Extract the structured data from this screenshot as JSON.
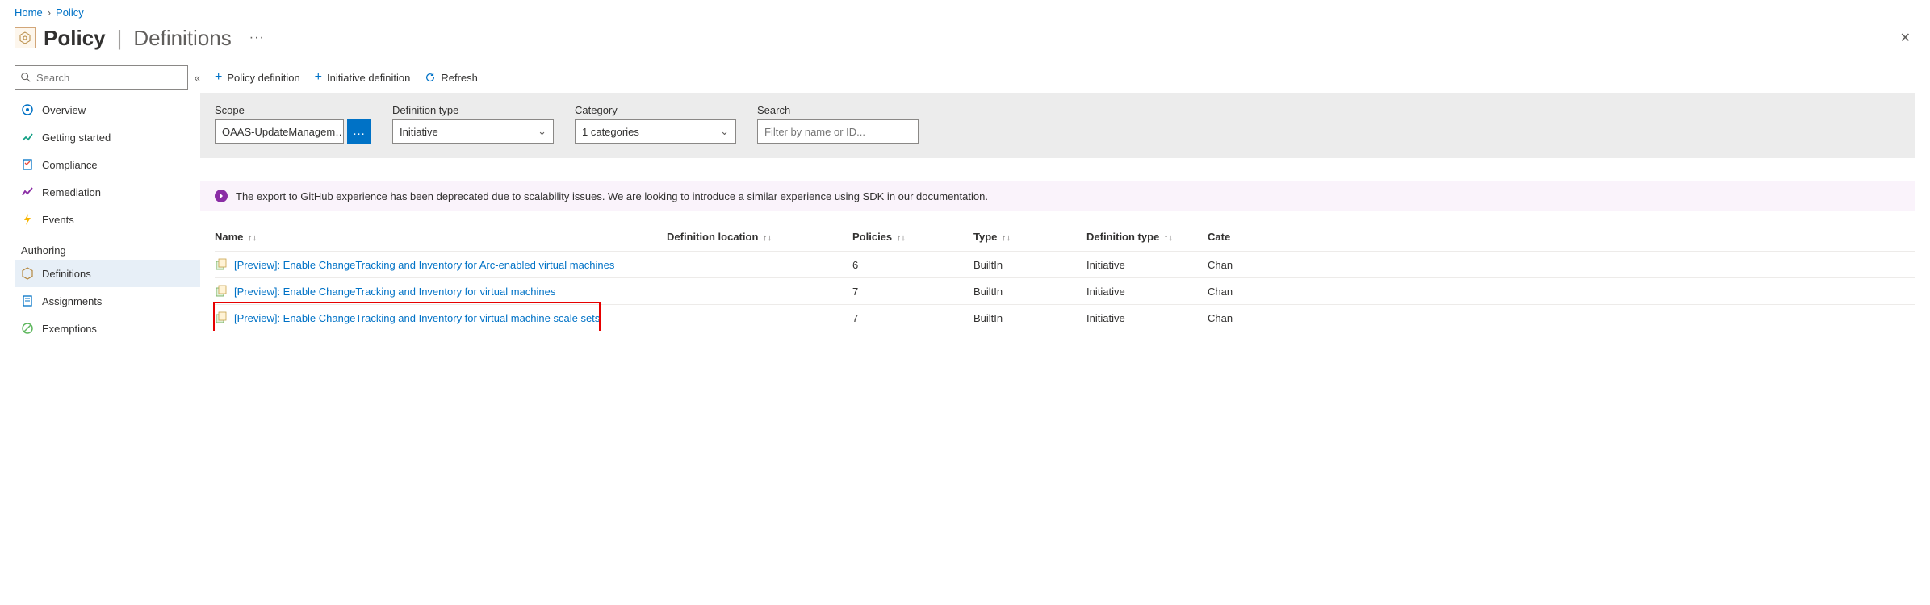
{
  "breadcrumb": {
    "home": "Home",
    "policy": "Policy"
  },
  "header": {
    "title": "Policy",
    "subtitle": "Definitions"
  },
  "sidebar": {
    "search_placeholder": "Search",
    "items": [
      {
        "label": "Overview"
      },
      {
        "label": "Getting started"
      },
      {
        "label": "Compliance"
      },
      {
        "label": "Remediation"
      },
      {
        "label": "Events"
      }
    ],
    "section": "Authoring",
    "auth_items": [
      {
        "label": "Definitions"
      },
      {
        "label": "Assignments"
      },
      {
        "label": "Exemptions"
      }
    ]
  },
  "toolbar": {
    "policy_def": "Policy definition",
    "initiative_def": "Initiative definition",
    "refresh": "Refresh"
  },
  "filters": {
    "scope_label": "Scope",
    "scope_value": "OAAS-UpdateManagem…",
    "deftype_label": "Definition type",
    "deftype_value": "Initiative",
    "category_label": "Category",
    "category_value": "1 categories",
    "search_label": "Search",
    "search_placeholder": "Filter by name or ID..."
  },
  "notice": "The export to GitHub experience has been deprecated due to scalability issues. We are looking to introduce a similar experience using SDK in our documentation.",
  "table": {
    "headers": {
      "name": "Name",
      "location": "Definition location",
      "policies": "Policies",
      "type": "Type",
      "deftype": "Definition type",
      "category": "Cate"
    },
    "rows": [
      {
        "name": "[Preview]: Enable ChangeTracking and Inventory for Arc-enabled virtual machines",
        "location": "",
        "policies": "6",
        "type": "BuiltIn",
        "deftype": "Initiative",
        "category": "Chan"
      },
      {
        "name": "[Preview]: Enable ChangeTracking and Inventory for virtual machines",
        "location": "",
        "policies": "7",
        "type": "BuiltIn",
        "deftype": "Initiative",
        "category": "Chan"
      },
      {
        "name": "[Preview]: Enable ChangeTracking and Inventory for virtual machine scale sets",
        "location": "",
        "policies": "7",
        "type": "BuiltIn",
        "deftype": "Initiative",
        "category": "Chan"
      }
    ]
  }
}
